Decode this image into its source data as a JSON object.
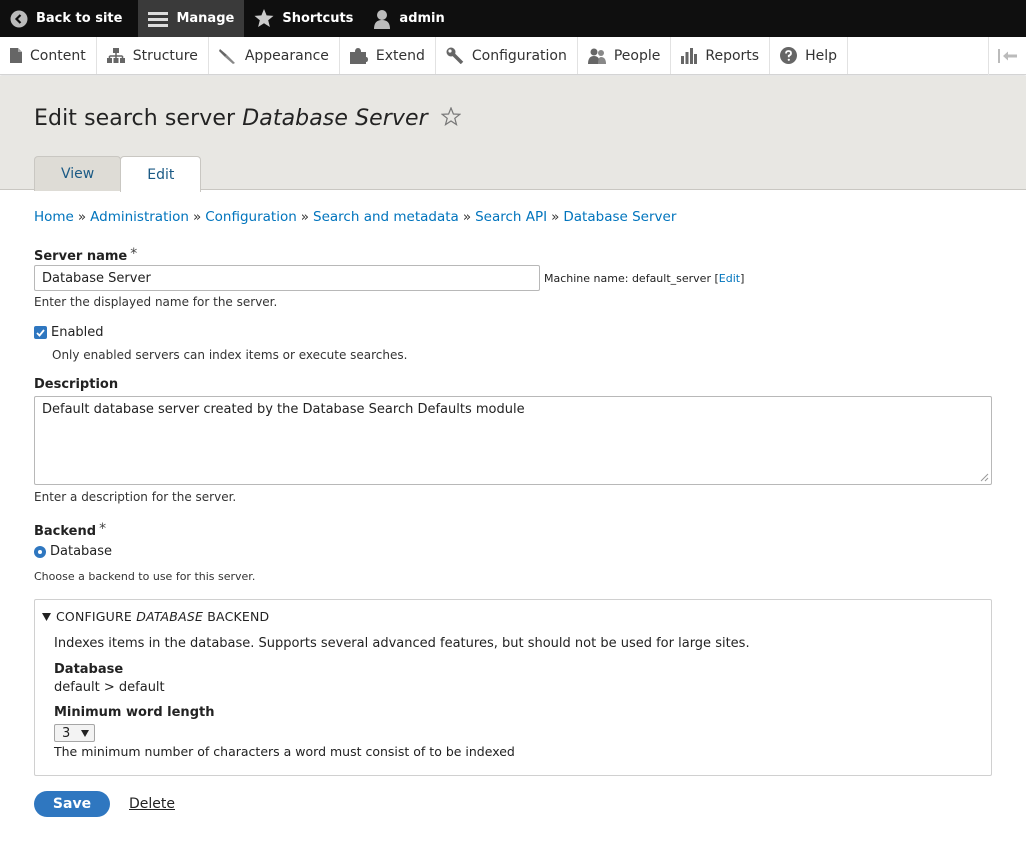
{
  "toolbar": {
    "back": "Back to site",
    "manage": "Manage",
    "shortcuts": "Shortcuts",
    "user": "admin"
  },
  "tray": {
    "items": [
      "Content",
      "Structure",
      "Appearance",
      "Extend",
      "Configuration",
      "People",
      "Reports",
      "Help"
    ]
  },
  "header": {
    "title_prefix": "Edit search server ",
    "title_name": "Database Server",
    "tabs": [
      "View",
      "Edit"
    ]
  },
  "breadcrumb": [
    "Home",
    "Administration",
    "Configuration",
    "Search and metadata",
    "Search API",
    "Database Server"
  ],
  "form": {
    "server_name_label": "Server name",
    "required_mark": "*",
    "server_name_value": "Database Server",
    "machine_name_prefix": "Machine name: default_server [",
    "machine_name_edit": "Edit",
    "machine_name_suffix": "]",
    "server_name_desc": "Enter the displayed name for the server.",
    "enabled_label": "Enabled",
    "enabled_checked": true,
    "enabled_desc": "Only enabled servers can index items or execute searches.",
    "description_label": "Description",
    "description_value": "Default database server created by the Database Search Defaults module",
    "description_desc": "Enter a description for the server.",
    "backend_label": "Backend",
    "backend_option": "Database",
    "backend_desc": "Choose a backend to use for this server."
  },
  "fieldset": {
    "title_prefix": "CONFIGURE ",
    "title_em": "DATABASE",
    "title_suffix": " BACKEND",
    "intro": "Indexes items in the database. Supports several advanced features, but should not be used for large sites.",
    "database_label": "Database",
    "database_value": "default > default",
    "min_word_label": "Minimum word length",
    "min_word_value": "3",
    "min_word_desc": "The minimum number of characters a word must consist of to be indexed"
  },
  "actions": {
    "save": "Save",
    "delete": "Delete"
  },
  "colors": {
    "accent": "#2f77c0",
    "link": "#0074bd",
    "toolbar_bg": "#0f0f0f",
    "header_bg": "#e8e7e3"
  }
}
